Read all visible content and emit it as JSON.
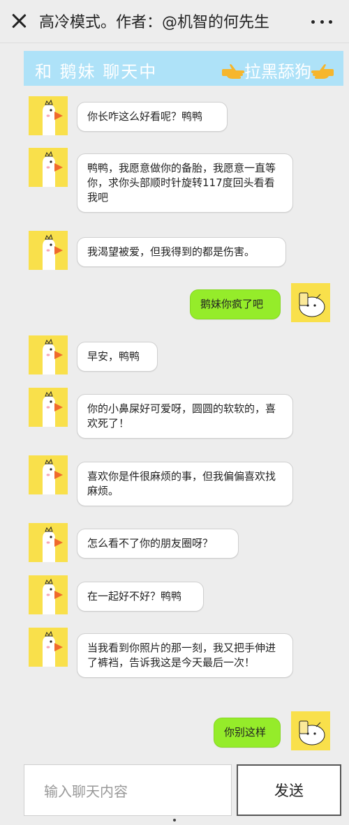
{
  "topbar": {
    "title": "高冷模式。作者：@机智的何先生"
  },
  "header": {
    "left_text": "和 鹅妹 聊天中",
    "right_text": "拉黑舔狗",
    "color": "#aee2f8"
  },
  "messages": [
    {
      "sender": "duck",
      "text": "你长咋这么好看呢？鸭鸭"
    },
    {
      "sender": "duck",
      "text": "鸭鸭，我愿意做你的备胎，我愿意一直等你，求你头部顺时针旋转117度回头看看我吧"
    },
    {
      "sender": "duck",
      "text": "我渴望被爱，但我得到的都是伤害。"
    },
    {
      "sender": "me",
      "text": "鹅妹你疯了吧"
    },
    {
      "sender": "duck",
      "text": "早安，鸭鸭"
    },
    {
      "sender": "duck",
      "text": "你的小鼻屎好可爱呀，圆圆的软软的，喜欢死了！"
    },
    {
      "sender": "duck",
      "text": "喜欢你是件很麻烦的事，但我偏偏喜欢找麻烦。"
    },
    {
      "sender": "duck",
      "text": "怎么看不了你的朋友圈呀？"
    },
    {
      "sender": "duck",
      "text": "在一起好不好？鸭鸭"
    },
    {
      "sender": "duck",
      "text": "当我看到你照片的那一刻，我又把手伸进了裤裆，告诉我这是今天最后一次！"
    },
    {
      "sender": "me",
      "text": "你别这样"
    }
  ],
  "input": {
    "placeholder": "输入聊天内容",
    "send_label": "发送"
  },
  "colors": {
    "my_bubble": "#95ec2a",
    "their_bubble": "#ffffff",
    "avatar_bg": "#f9e04b"
  }
}
